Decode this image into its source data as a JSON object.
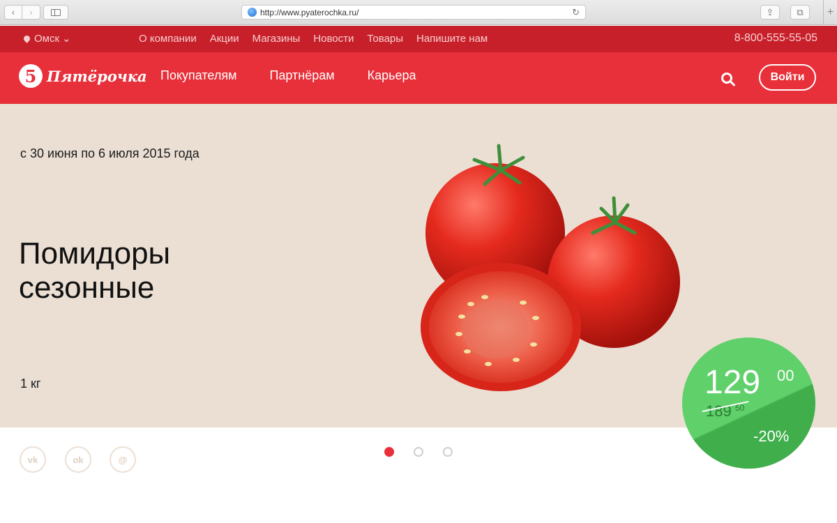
{
  "browser": {
    "url": "http://www.pyaterochka.ru/",
    "back_icon": "‹",
    "forward_icon": "›",
    "reload_icon": "↻",
    "share_icon": "⇪",
    "tabs_icon": "⧉",
    "new_tab_icon": "+"
  },
  "topbar": {
    "city": "Омск",
    "city_chevron": "⌄",
    "nav": [
      "О компании",
      "Акции",
      "Магазины",
      "Новости",
      "Товары",
      "Напишите нам"
    ],
    "phone": "8-800-555-55-05"
  },
  "header": {
    "logo_mark": "5",
    "logo_text": "Пятёрочка",
    "nav": [
      "Покупателям",
      "Партнёрам",
      "Карьера"
    ],
    "login_label": "Войти"
  },
  "hero": {
    "dates": "с 30 июня по 6 июля 2015 года",
    "title": "Помидоры сезонные",
    "weight": "1 кг",
    "price_main": "129",
    "price_main_kop": "00",
    "price_old": "189",
    "price_old_kop": "50",
    "discount": "-20%"
  },
  "social": {
    "vk_label": "vk",
    "ok_label": "ok",
    "mail_label": "@"
  },
  "carousel": {
    "slides": 3,
    "active_index": 0
  },
  "colors": {
    "brand_red": "#e8303a",
    "dark_red": "#c8202a",
    "hero_bg": "#ebdfd4",
    "price_green": "#5fd06a"
  }
}
